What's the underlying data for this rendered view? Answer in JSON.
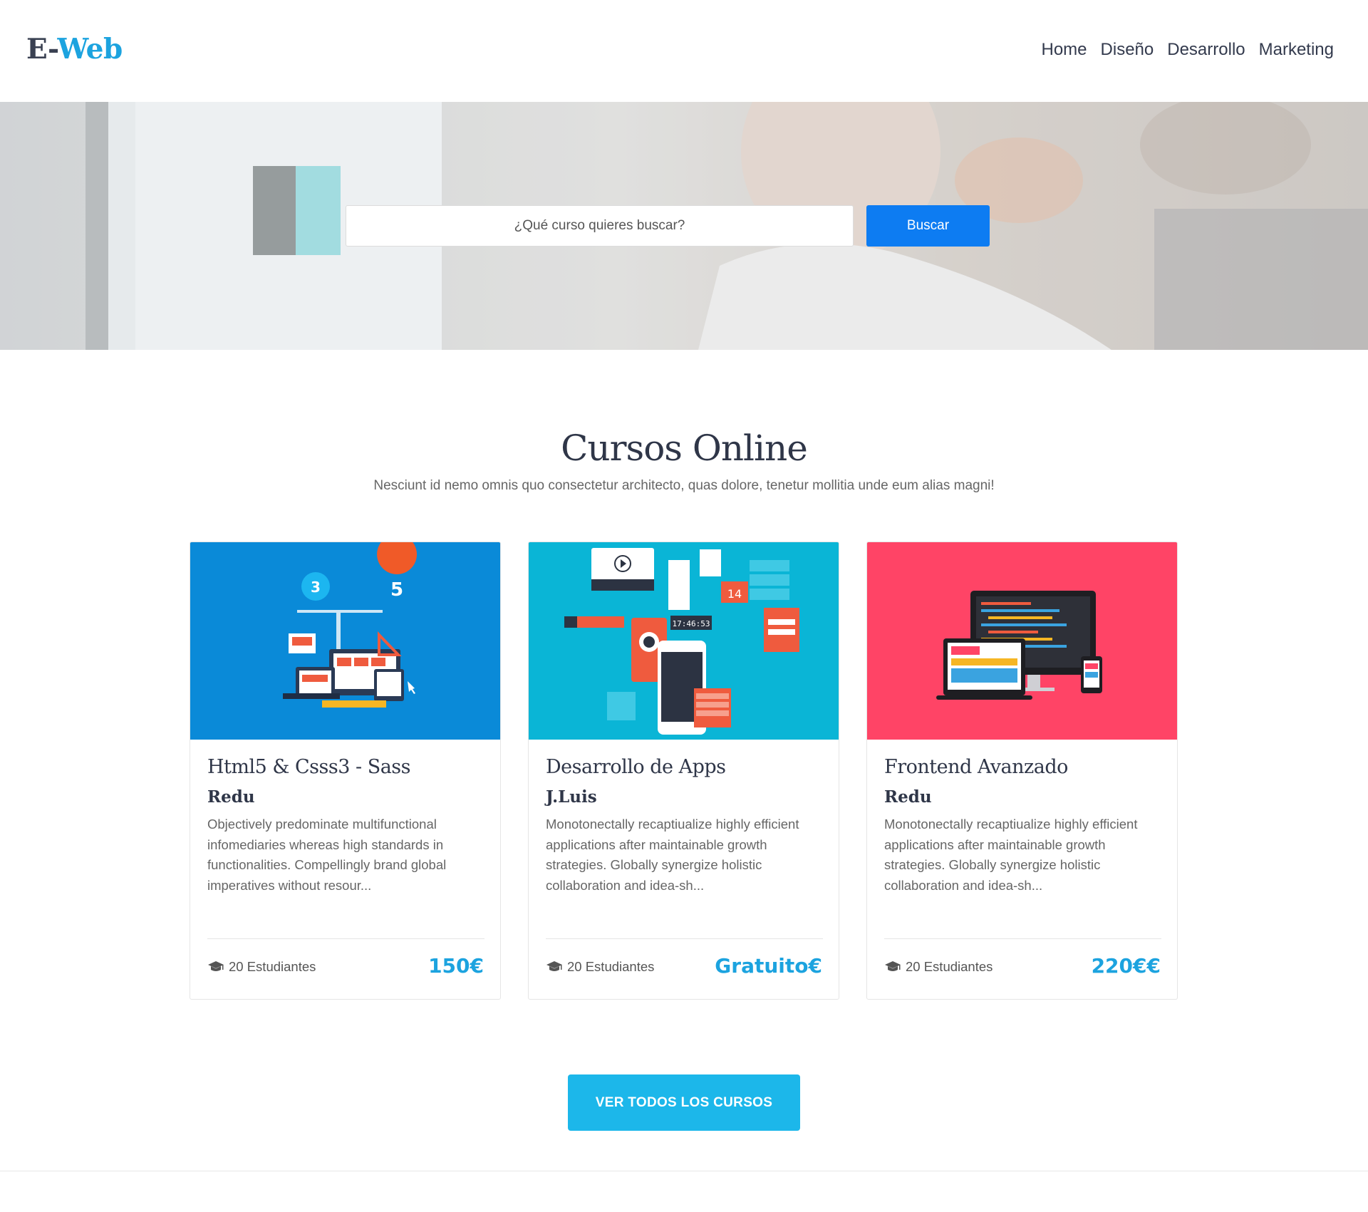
{
  "brand": {
    "part1": "E-",
    "part2": "Web"
  },
  "nav": [
    {
      "label": "Home"
    },
    {
      "label": "Diseño"
    },
    {
      "label": "Desarrollo"
    },
    {
      "label": "Marketing"
    }
  ],
  "search": {
    "placeholder": "¿Qué curso quieres buscar?",
    "button_label": "Buscar"
  },
  "section": {
    "title": "Cursos Online",
    "subtitle": "Nesciunt id nemo omnis quo consectetur architecto, quas dolore, tenetur mollitia unde eum alias magni!"
  },
  "courses": [
    {
      "title": "Html5 & Csss3 - Sass",
      "author": "Redu",
      "description": "Objectively predominate multifunctional infomediaries whereas high standards in functionalities. Compellingly brand global imperatives without resour...",
      "students": "20 Estudiantes",
      "price": "150€",
      "color": "#0a8ad8"
    },
    {
      "title": "Desarrollo de Apps",
      "author": "J.Luis",
      "description": "Monotonectally recaptiualize highly efficient applications after maintainable growth strategies. Globally synergize holistic collaboration and idea-sh...",
      "students": "20 Estudiantes",
      "price": "Gratuito€",
      "color": "#0ab5d6"
    },
    {
      "title": "Frontend Avanzado",
      "author": "Redu",
      "description": "Monotonectally recaptiualize highly efficient applications after maintainable growth strategies. Globally synergize holistic collaboration and idea-sh...",
      "students": "20 Estudiantes",
      "price": "220€€",
      "color": "#ff4466"
    }
  ],
  "cta": {
    "label": "VER TODOS LOS CURSOS"
  }
}
